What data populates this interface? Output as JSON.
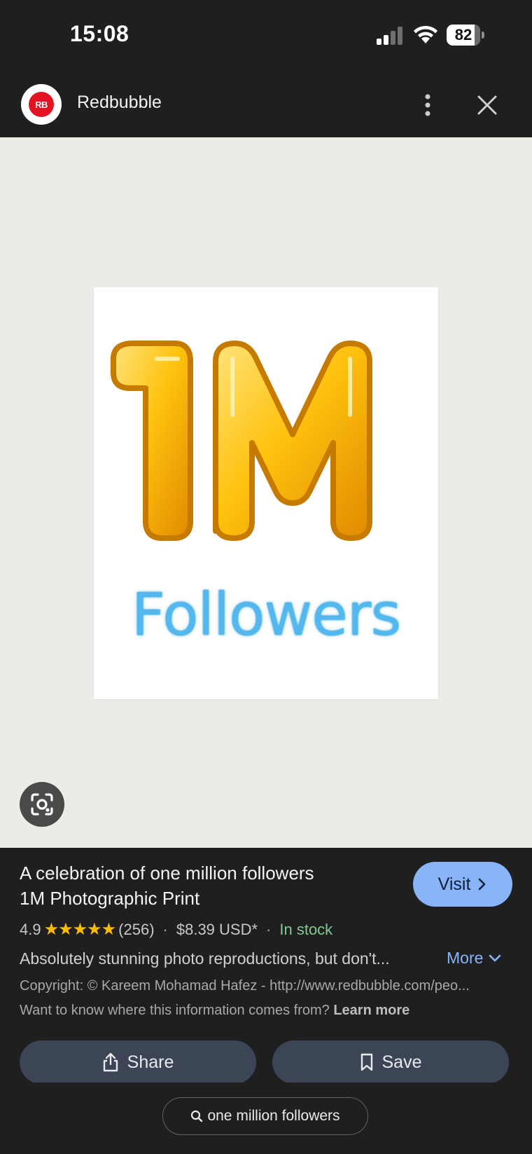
{
  "status_bar": {
    "time": "15:08",
    "battery": "82"
  },
  "header": {
    "logo_text": "RB",
    "site_name": "Redbubble"
  },
  "image": {
    "main_text": "1M",
    "sub_text": "Followers"
  },
  "product": {
    "title_line1": "A celebration of one million followers",
    "title_line2": "1M Photographic Print",
    "visit_label": "Visit",
    "rating": "4.9",
    "stars": "★★★★★",
    "reviews": "(256)",
    "price": "$8.39 USD*",
    "availability": "In stock",
    "description": "Absolutely stunning photo reproductions, but don't...",
    "more_label": "More",
    "copyright": "Copyright: © Kareem Mohamad Hafez - http://www.redbubble.com/peo...",
    "source_question": "Want to know where this information comes from?",
    "learn_more": "Learn more"
  },
  "actions": {
    "share_label": "Share",
    "save_label": "Save"
  },
  "search": {
    "query": "one million followers"
  },
  "colors": {
    "accent_blue": "#8ab4f8",
    "stock_green": "#81c995",
    "star_yellow": "#fbbc04",
    "logo_red": "#e41321"
  }
}
